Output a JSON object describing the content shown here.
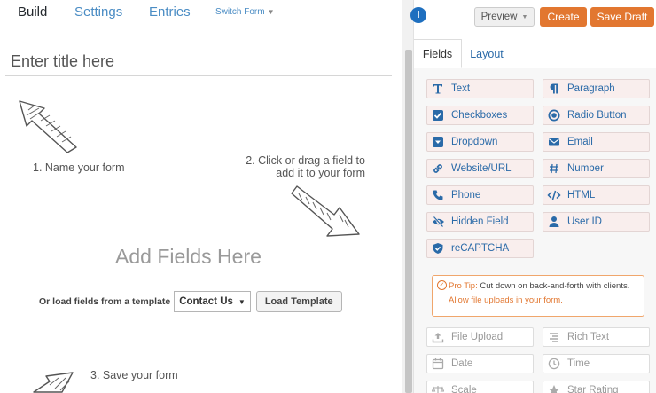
{
  "nav": {
    "tabs": [
      "Build",
      "Settings",
      "Entries"
    ],
    "switch_form": "Switch Form"
  },
  "builder": {
    "title_placeholder": "Enter title here",
    "hint_1": "1. Name your form",
    "hint_2_line1": "2. Click or drag a field to",
    "hint_2_line2": "add it to your form",
    "hint_3": "3. Save your form",
    "add_fields": "Add Fields Here",
    "template_label": "Or load fields from a template",
    "template_selected": "Contact Us",
    "load_template": "Load Template"
  },
  "toolbar": {
    "info_icon": "i",
    "preview": "Preview",
    "create": "Create",
    "save_draft": "Save Draft"
  },
  "panel_tabs": {
    "fields": "Fields",
    "layout": "Layout"
  },
  "fields": [
    {
      "label": "Text",
      "icon": "text-icon"
    },
    {
      "label": "Paragraph",
      "icon": "paragraph-icon"
    },
    {
      "label": "Checkboxes",
      "icon": "checkbox-icon"
    },
    {
      "label": "Radio Button",
      "icon": "radio-icon"
    },
    {
      "label": "Dropdown",
      "icon": "dropdown-icon"
    },
    {
      "label": "Email",
      "icon": "envelope-icon"
    },
    {
      "label": "Website/URL",
      "icon": "link-icon"
    },
    {
      "label": "Number",
      "icon": "hash-icon"
    },
    {
      "label": "Phone",
      "icon": "phone-icon"
    },
    {
      "label": "HTML",
      "icon": "code-icon"
    },
    {
      "label": "Hidden Field",
      "icon": "eye-slash-icon"
    },
    {
      "label": "User ID",
      "icon": "user-icon"
    },
    {
      "label": "reCAPTCHA",
      "icon": "shield-icon"
    }
  ],
  "pro_tip": {
    "label": "Pro Tip:",
    "text": "Cut down on back-and-forth with clients.",
    "link": "Allow file uploads in your form."
  },
  "pro_fields": [
    {
      "label": "File Upload",
      "icon": "upload-icon"
    },
    {
      "label": "Rich Text",
      "icon": "align-icon"
    },
    {
      "label": "Date",
      "icon": "calendar-icon"
    },
    {
      "label": "Time",
      "icon": "clock-icon"
    },
    {
      "label": "Scale",
      "icon": "scale-icon"
    },
    {
      "label": "Star Rating",
      "icon": "star-icon"
    }
  ],
  "colors": {
    "accent_orange": "#e27730",
    "link_blue": "#2a6aa8",
    "field_bg": "#f9eeed",
    "info_blue": "#1e6fbf"
  }
}
